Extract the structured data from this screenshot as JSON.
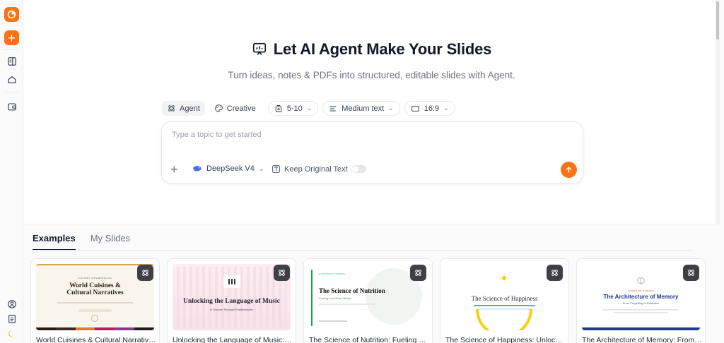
{
  "hero": {
    "title": "Let AI Agent Make Your Slides",
    "subtitle": "Turn ideas, notes & PDFs into structured, editable slides with Agent."
  },
  "options": {
    "modes": [
      {
        "label": "Agent",
        "icon": "agent-icon",
        "active": true
      },
      {
        "label": "Creative",
        "icon": "palette-icon",
        "active": false
      }
    ],
    "slide_count": "5-10",
    "text_amount": "Medium text",
    "aspect_ratio": "16:9"
  },
  "prompt": {
    "placeholder": "Type a topic to get started",
    "value": "",
    "model": "DeepSeek V4",
    "keep_original_label": "Keep Original Text",
    "keep_original_on": false
  },
  "tabs": [
    {
      "label": "Examples",
      "active": true
    },
    {
      "label": "My Slides",
      "active": false
    }
  ],
  "cards": [
    {
      "title": "World Cuisines & Cultural Narratives",
      "thumb_title_1": "World Cuisines &",
      "thumb_title_2": "Cultural Narratives"
    },
    {
      "title": "Unlocking the Language of Music: A Journey Through Fundamentals",
      "thumb_title": "Unlocking the Language of Music",
      "thumb_subtitle": "A Journey Through Fundamentals"
    },
    {
      "title": "The Science of Nutrition: Fueling Your Body Wisely",
      "thumb_title": "The Science of Nutrition",
      "thumb_subtitle": "Fueling Your Body Wisely"
    },
    {
      "title": "The Science of Happiness: Unlocking Your Well-being",
      "thumb_title": "The Science of Happiness"
    },
    {
      "title": "The Architecture of Memory: From Forgetting to Retention",
      "thumb_title": "The Architecture of Memory",
      "thumb_subtitle": "From Forgetting to Retention"
    }
  ],
  "colors": {
    "accent": "#f97316",
    "badge": "#3f3f46",
    "memory_navy": "#1e3a8a",
    "nutrition_green": "#16a34a",
    "happiness_yellow": "#facc15"
  }
}
